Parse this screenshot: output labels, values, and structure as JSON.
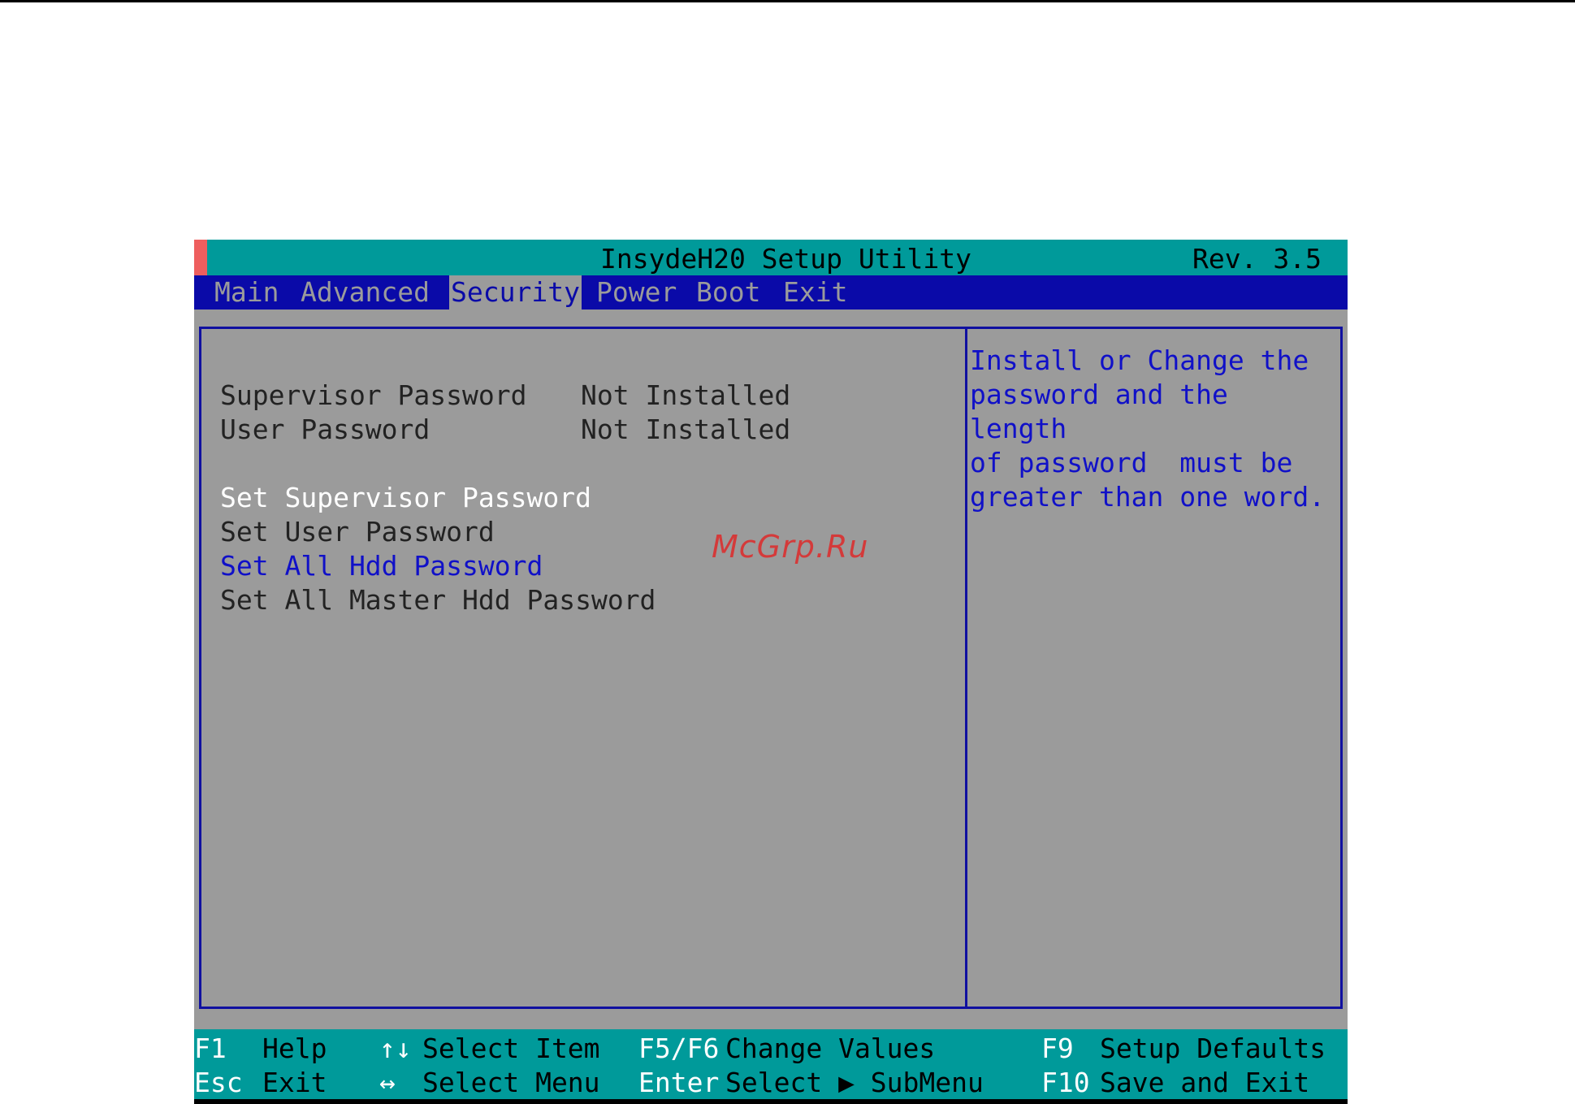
{
  "window": {
    "title": "InsydeH20 Setup Utility",
    "revision": "Rev. 3.5"
  },
  "menu": {
    "tabs": [
      {
        "label": "Main",
        "active": false
      },
      {
        "label": "Advanced",
        "active": false
      },
      {
        "label": "Security",
        "active": true
      },
      {
        "label": "Power",
        "active": false
      },
      {
        "label": "Boot",
        "active": false
      },
      {
        "label": "Exit",
        "active": false
      }
    ]
  },
  "security": {
    "status_rows": [
      {
        "label": "Supervisor Password",
        "value": "Not Installed"
      },
      {
        "label": "User Password",
        "value": "Not Installed"
      }
    ],
    "actions": [
      {
        "label": "Set Supervisor Password",
        "state": "selected"
      },
      {
        "label": "Set User Password",
        "state": "normal"
      },
      {
        "label": "Set All Hdd Password",
        "state": "link"
      },
      {
        "label": "Set All Master Hdd Password",
        "state": "normal"
      }
    ]
  },
  "help": {
    "text": "Install or Change the\npassword and the length\nof password  must be\ngreater than one word."
  },
  "watermark": "McGrp.Ru",
  "footer": {
    "keys": [
      {
        "key": "F1",
        "label": "Help"
      },
      {
        "key": "Esc",
        "label": "Exit"
      },
      {
        "key": "↑↓",
        "label": "Select Item"
      },
      {
        "key": "↔",
        "label": "Select Menu"
      },
      {
        "key": "F5/F6",
        "label": "Change Values"
      },
      {
        "key": "Enter",
        "label": "Select ▶ SubMenu"
      },
      {
        "key": "F9",
        "label": "Setup Defaults"
      },
      {
        "key": "F10",
        "label": "Save and Exit"
      }
    ]
  },
  "colors": {
    "title_bar": "#009a9a",
    "menu_bar": "#0a0aa8",
    "body": "#9b9b9b",
    "accent": "#ee5e5e",
    "help_text": "#1010c8"
  }
}
